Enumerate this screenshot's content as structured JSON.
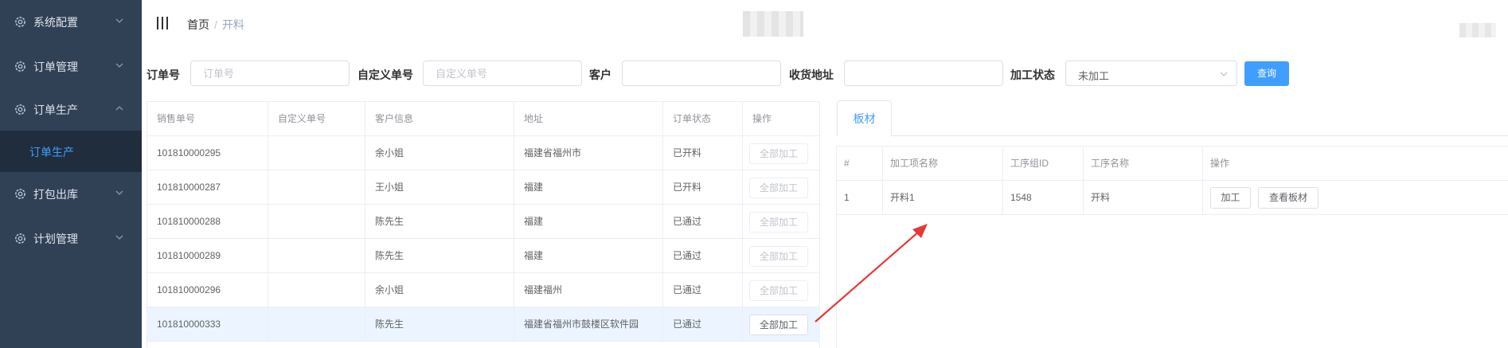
{
  "sidebar": {
    "items": [
      {
        "label": "系统配置",
        "icon": "gear-icon",
        "chevron": "chevron-down-icon"
      },
      {
        "label": "订单管理",
        "icon": "gear-icon",
        "chevron": "chevron-down-icon"
      },
      {
        "label": "订单生产",
        "icon": "gear-icon",
        "chevron": "chevron-up-icon"
      },
      {
        "label": "打包出库",
        "icon": "gear-icon",
        "chevron": "chevron-down-icon"
      },
      {
        "label": "计划管理",
        "icon": "gear-icon",
        "chevron": "chevron-down-icon"
      }
    ],
    "submenu": {
      "label": "订单生产"
    }
  },
  "header": {
    "breadcrumb": {
      "home": "首页",
      "separator": "/",
      "current": "开料"
    }
  },
  "search": {
    "order_no": {
      "label": "订单号",
      "placeholder": "订单号",
      "value": ""
    },
    "custom_no": {
      "label": "自定义单号",
      "placeholder": "自定义单号",
      "value": ""
    },
    "customer": {
      "label": "客户",
      "placeholder": "",
      "value": ""
    },
    "address": {
      "label": "收货地址",
      "placeholder": "",
      "value": ""
    },
    "status": {
      "label": "加工状态",
      "value": "未加工"
    },
    "query_label": "查询"
  },
  "orders": {
    "columns": [
      "销售单号",
      "自定义单号",
      "客户信息",
      "地址",
      "订单状态",
      "操作"
    ],
    "rows": [
      {
        "sale_no": "101810000295",
        "custom_no": "",
        "customer": "余小姐",
        "address": "福建省福州市",
        "status": "已开料",
        "action": "全部加工",
        "enabled": false
      },
      {
        "sale_no": "101810000287",
        "custom_no": "",
        "customer": "王小姐",
        "address": "福建",
        "status": "已开料",
        "action": "全部加工",
        "enabled": false
      },
      {
        "sale_no": "101810000288",
        "custom_no": "",
        "customer": "陈先生",
        "address": "福建",
        "status": "已通过",
        "action": "全部加工",
        "enabled": false
      },
      {
        "sale_no": "101810000289",
        "custom_no": "",
        "customer": "陈先生",
        "address": "福建",
        "status": "已通过",
        "action": "全部加工",
        "enabled": false
      },
      {
        "sale_no": "101810000296",
        "custom_no": "",
        "customer": "余小姐",
        "address": "福建福州",
        "status": "已通过",
        "action": "全部加工",
        "enabled": false
      },
      {
        "sale_no": "101810000333",
        "custom_no": "",
        "customer": "陈先生",
        "address": "福建省福州市鼓楼区软件园",
        "status": "已通过",
        "action": "全部加工",
        "enabled": true
      }
    ]
  },
  "detail": {
    "tab": "板材",
    "columns": [
      "#",
      "加工项名称",
      "工序组ID",
      "工序名称",
      "操作"
    ],
    "rows": [
      {
        "index": "1",
        "item_name": "开料1",
        "group_id": "1548",
        "process_name": "开料",
        "btn_process": "加工",
        "btn_view": "查看板材"
      }
    ]
  },
  "colors": {
    "sidebar_bg": "#304156",
    "accent": "#409eff",
    "arrow": "#e53935"
  }
}
